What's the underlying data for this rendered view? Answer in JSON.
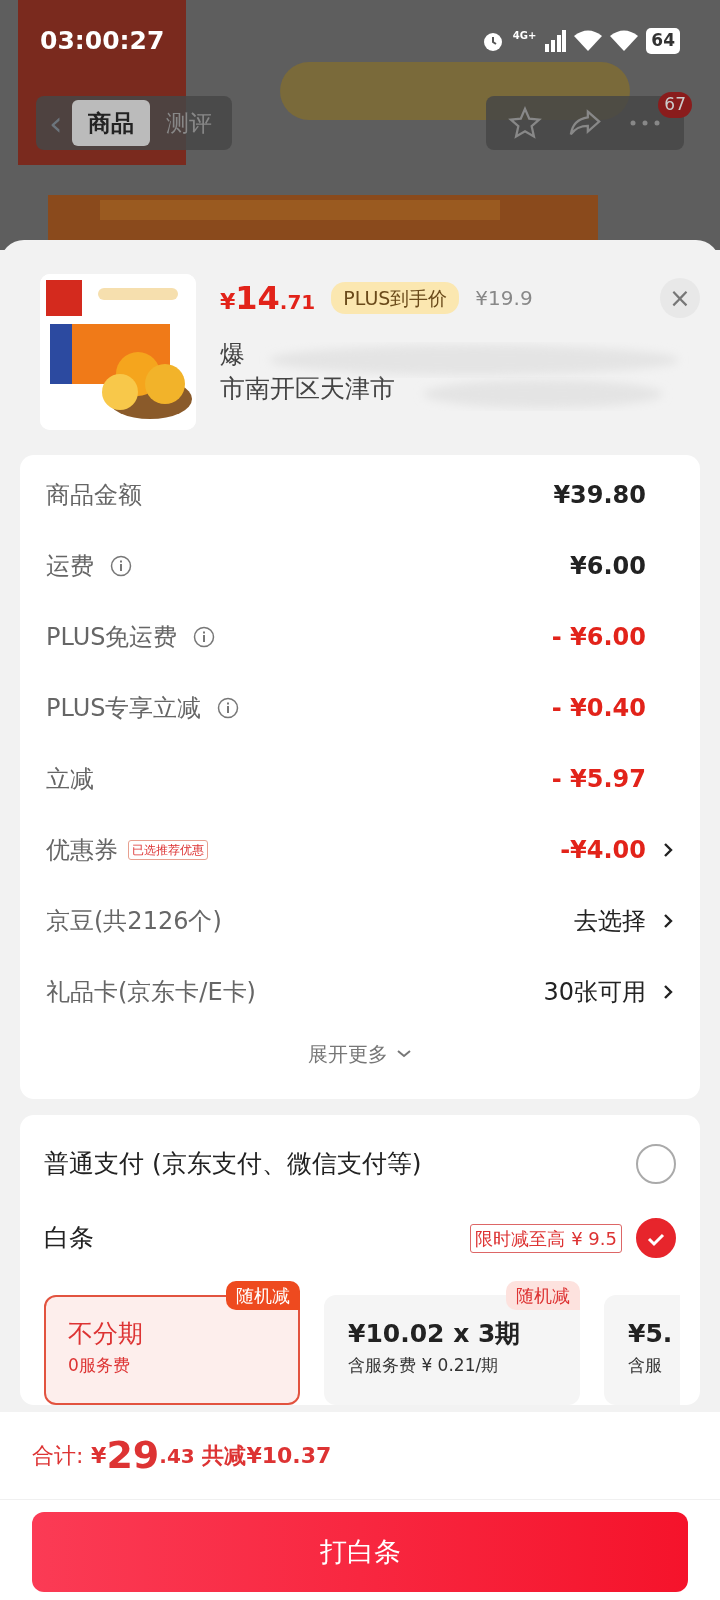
{
  "status_bar": {
    "time": "03:00:27",
    "network": "4G+",
    "battery": "64"
  },
  "nav": {
    "back": "‹",
    "tabs": [
      {
        "label": "商品",
        "selected": true
      },
      {
        "label": "测评",
        "selected": false
      }
    ],
    "badge": "67"
  },
  "product": {
    "price_symbol": "¥",
    "price_int": "14",
    "price_dec": ".71",
    "price_tag": "PLUS到手价",
    "original_price": "¥19.9",
    "close": "×",
    "address_lines": [
      "爆",
      "市南开区天津市"
    ]
  },
  "costs": [
    {
      "label": "商品金额",
      "info": false,
      "value": "¥39.80",
      "kind": "amount",
      "chevron": false
    },
    {
      "label": "运费",
      "info": true,
      "value": "¥6.00",
      "kind": "amount",
      "chevron": false
    },
    {
      "label": "PLUS免运费",
      "info": true,
      "value": "- ¥6.00",
      "kind": "discount",
      "chevron": false
    },
    {
      "label": "PLUS专享立减",
      "info": true,
      "value": "- ¥0.40",
      "kind": "discount",
      "chevron": false
    },
    {
      "label": "立减",
      "info": false,
      "value": "- ¥5.97",
      "kind": "discount",
      "chevron": false
    },
    {
      "label": "优惠券",
      "info": false,
      "tag": "已选推荐优惠",
      "value": "-¥4.00",
      "kind": "discount",
      "chevron": true
    },
    {
      "label": "京豆(共2126个)",
      "info": false,
      "value": "去选择",
      "kind": "action",
      "chevron": true
    },
    {
      "label": "礼品卡(京东卡/E卡)",
      "info": false,
      "value": "30张可用",
      "kind": "action",
      "chevron": true
    }
  ],
  "expand": "展开更多",
  "payment_methods": [
    {
      "label": "普通支付 (京东支付、微信支付等)",
      "selected": false
    },
    {
      "label": "白条",
      "tag": "限时减至高 ¥ 9.5",
      "selected": true
    }
  ],
  "installments": [
    {
      "title": "不分期",
      "subtitle": "0服务费",
      "badge": "随机减",
      "selected": true
    },
    {
      "title": "¥10.02 x 3期",
      "subtitle": "含服务费 ¥ 0.21/期",
      "badge": "随机减",
      "selected": false
    },
    {
      "title": "¥5.",
      "subtitle": "含服",
      "selected": false
    }
  ],
  "total": {
    "label": "合计:",
    "symbol": "¥",
    "int": "29",
    "dec": ".43",
    "saved": "共减¥10.37"
  },
  "submit": "打白条"
}
